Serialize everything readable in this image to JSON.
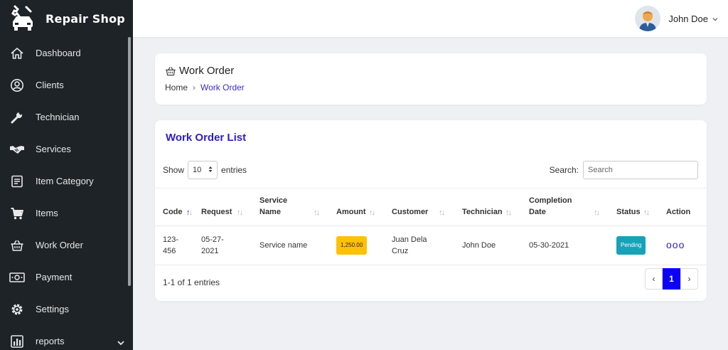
{
  "app": {
    "name": "Repair Shop"
  },
  "sidebar": {
    "items": [
      {
        "label": "Dashboard",
        "icon": "home-icon"
      },
      {
        "label": "Clients",
        "icon": "user-circle-icon"
      },
      {
        "label": "Technician",
        "icon": "wrench-icon"
      },
      {
        "label": "Services",
        "icon": "handshake-icon"
      },
      {
        "label": "Item Category",
        "icon": "list-icon"
      },
      {
        "label": "Items",
        "icon": "cart-icon"
      },
      {
        "label": "Work Order",
        "icon": "basket-icon"
      },
      {
        "label": "Payment",
        "icon": "money-icon"
      },
      {
        "label": "Settings",
        "icon": "gear-icon"
      },
      {
        "label": "reports",
        "icon": "bar-chart-icon"
      }
    ]
  },
  "topbar": {
    "user_name": "John Doe"
  },
  "header": {
    "title": "Work Order",
    "breadcrumb": {
      "home": "Home",
      "separator": "›",
      "current": "Work Order"
    }
  },
  "list": {
    "title": "Work Order List",
    "show_label": "Show",
    "entries_value": "10",
    "entries_label": "entries",
    "search_label": "Search:",
    "search_placeholder": "Search",
    "columns": [
      "Code",
      "Request",
      "Service Name",
      "Amount",
      "Customer",
      "Technician",
      "Completion Date",
      "Status",
      "Action"
    ],
    "rows": [
      {
        "code": "123-456",
        "request": "05-27-2021",
        "service_name": "Service name",
        "amount": "1,250.00",
        "customer": "Juan Dela Cruz",
        "technician": "John Doe",
        "completion_date": "05-30-2021",
        "status": "Pending",
        "action": "ooo"
      }
    ],
    "info": "1-1 of 1 entries",
    "pagination": {
      "prev": "‹",
      "current": "1",
      "next": "›"
    }
  },
  "colors": {
    "sidebar": "#1d2327",
    "accent": "#2b1bd6",
    "page_active": "#0d00f5",
    "amount_badge": "#ffc107",
    "status_badge": "#17a2b8"
  }
}
